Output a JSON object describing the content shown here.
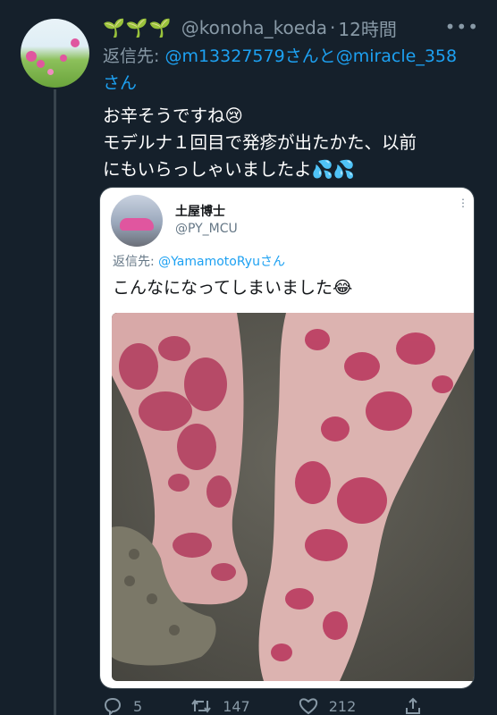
{
  "tweet": {
    "icons": "🌱🌱🌱",
    "handle": "@konoha_koeda",
    "separator": "·",
    "time": "12時間",
    "more": "•••",
    "reply_label": "返信先: ",
    "reply_mention_1": "@m13327579",
    "reply_connector": "さんと",
    "reply_mention_2": "@miracle_358",
    "reply_suffix": "さん",
    "text_line_1": "お辛そうですね",
    "emoji_1": "😢",
    "text_line_2": "モデルナ１回目で発疹が出たかた、以前",
    "text_line_3": "にもいらっしゃいましたよ",
    "emoji_2": "💦💦"
  },
  "quote": {
    "name": "土屋博士",
    "handle": "@PY_MCU",
    "more": "⋮",
    "reply_label": "返信先: ",
    "reply_mention": "@YamamotoRyu",
    "reply_suffix": "さん",
    "text": "こんなになってしまいました",
    "emoji": "😂"
  },
  "actions": {
    "reply_count": "5",
    "retweet_count": "147",
    "like_count": "212"
  },
  "colors": {
    "background": "#15202b",
    "accent": "#1da1f2",
    "muted": "#8899a6"
  }
}
